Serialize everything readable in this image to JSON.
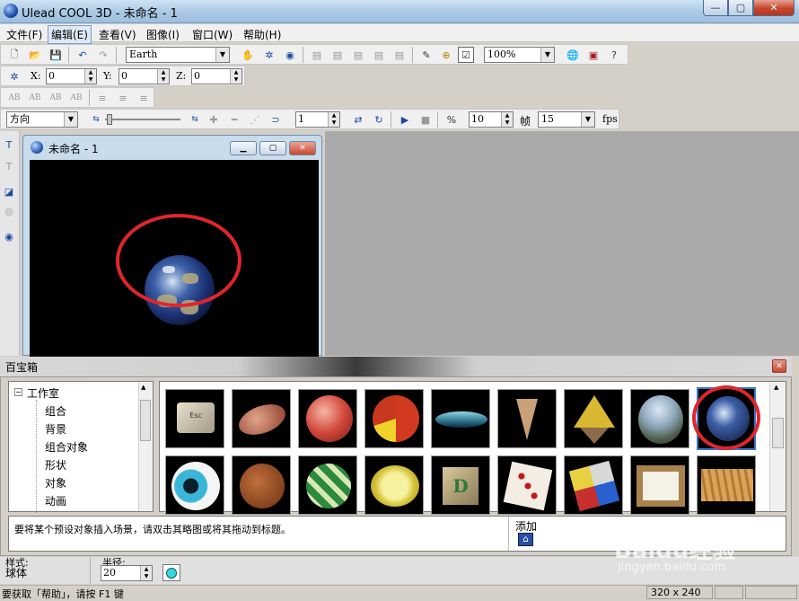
{
  "app": {
    "title": "Ulead COOL 3D - 未命名 - 1"
  },
  "window_buttons": {
    "min": "—",
    "max": "▢",
    "close": "✕"
  },
  "menu": [
    {
      "label": "文件(F)"
    },
    {
      "label": "编辑(E)"
    },
    {
      "label": "查看(V)"
    },
    {
      "label": "图像(I)"
    },
    {
      "label": "窗口(W)"
    },
    {
      "label": "帮助(H)"
    }
  ],
  "toolbar1": {
    "object_select": "Earth",
    "zoom": "100%"
  },
  "toolbar2": {
    "x_label": "X:",
    "x_value": "0",
    "y_label": "Y:",
    "y_value": "0",
    "z_label": "Z:",
    "z_value": "0"
  },
  "toolbar3": {
    "icons": [
      "AB",
      "AB",
      "AB",
      "AB"
    ]
  },
  "toolbar4": {
    "direction": "方向",
    "frame_value": "1",
    "frames_total": "10",
    "frames_label": "帧",
    "fps_value": "15",
    "fps_label": "fps"
  },
  "docwin": {
    "title": "未命名 - 1"
  },
  "easypalette": {
    "title": "百宝箱",
    "tree": {
      "root": "工作室",
      "items": [
        "组合",
        "背景",
        "组合对象",
        "形状",
        "对象",
        "动画"
      ]
    },
    "row1": [
      "Esc键",
      "橄榄球",
      "篮球",
      "彩色球",
      "飞碟",
      "锥形",
      "宝塔",
      "山景球",
      "地球"
    ],
    "row2": [
      "眼球",
      "毛球",
      "花纹球",
      "柠檬片",
      "字母D块",
      "骰子",
      "魔方",
      "画框",
      "木纹"
    ],
    "hint": "要将某个预设对象插入场景，请双击其略图或将其拖动到标题。",
    "add_label": "添加"
  },
  "status_row": {
    "style_label": "样式:",
    "style_value": "球体",
    "radius_label": "半径:",
    "radius_value": "20"
  },
  "statusbar": {
    "help": "要获取「帮助」，请按 F1 键",
    "size": "320 x 240"
  },
  "watermark": {
    "brand": "Baidu经验",
    "url": "jingyan.baidu.com"
  },
  "colors": {
    "accent_red": "#e0262b",
    "titlebar": "#a9c8e4",
    "selection": "#3a74c9"
  }
}
